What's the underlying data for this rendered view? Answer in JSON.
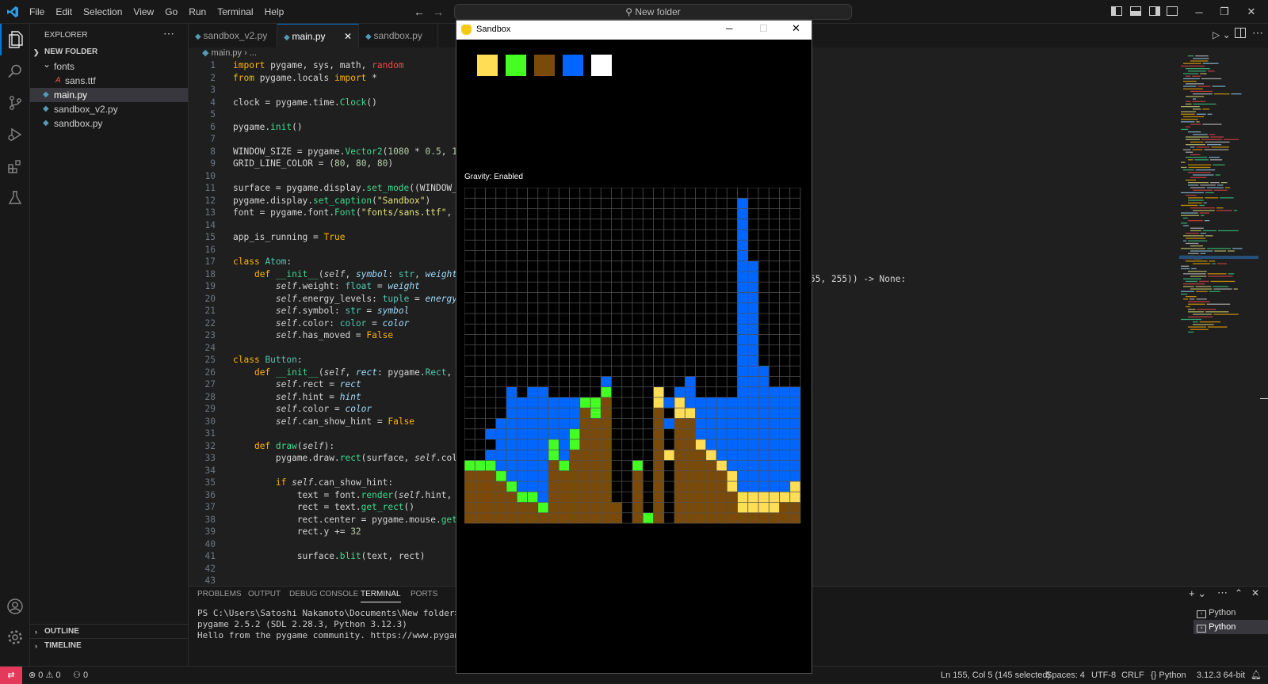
{
  "menu": [
    "File",
    "Edit",
    "Selection",
    "View",
    "Go",
    "Run",
    "Terminal",
    "Help"
  ],
  "command_center": "New folder",
  "explorer": {
    "header": "EXPLORER",
    "folder": "NEW FOLDER",
    "items": [
      {
        "label": "fonts",
        "type": "folder",
        "depth": 1
      },
      {
        "label": "sans.ttf",
        "type": "font",
        "depth": 2
      },
      {
        "label": "main.py",
        "type": "py",
        "depth": 1,
        "selected": true
      },
      {
        "label": "sandbox_v2.py",
        "type": "py",
        "depth": 1
      },
      {
        "label": "sandbox.py",
        "type": "py",
        "depth": 1
      }
    ],
    "outline": "OUTLINE",
    "timeline": "TIMELINE"
  },
  "tabs": [
    {
      "label": "sandbox_v2.py",
      "active": false
    },
    {
      "label": "main.py",
      "active": true
    },
    {
      "label": "sandbox.py",
      "active": false
    }
  ],
  "breadcrumb": [
    "main.py",
    "..."
  ],
  "code_lines": [
    [
      [
        "kw",
        "import"
      ],
      [
        "op",
        " pygame, sys, math, "
      ],
      [
        "var",
        "random"
      ]
    ],
    [
      [
        "kw",
        "from"
      ],
      [
        "op",
        " pygame.locals "
      ],
      [
        "kw",
        "import"
      ],
      [
        "op",
        " *"
      ]
    ],
    [],
    [
      [
        "op",
        "clock = pygame.time."
      ],
      [
        "fn",
        "Clock"
      ],
      [
        "op",
        "()"
      ]
    ],
    [],
    [
      [
        "op",
        "pygame."
      ],
      [
        "fn",
        "init"
      ],
      [
        "op",
        "()"
      ]
    ],
    [],
    [
      [
        "op",
        "WINDOW_SIZE = pygame."
      ],
      [
        "fn",
        "Vector2"
      ],
      [
        "op",
        "("
      ],
      [
        "num",
        "1080"
      ],
      [
        "op",
        " * "
      ],
      [
        "num",
        "0.5"
      ],
      [
        "op",
        ", "
      ],
      [
        "num",
        "192"
      ]
    ],
    [
      [
        "op",
        "GRID_LINE_COLOR = ("
      ],
      [
        "num",
        "80"
      ],
      [
        "op",
        ", "
      ],
      [
        "num",
        "80"
      ],
      [
        "op",
        ", "
      ],
      [
        "num",
        "80"
      ],
      [
        "op",
        ")"
      ]
    ],
    [],
    [
      [
        "op",
        "surface = pygame.display."
      ],
      [
        "fn",
        "set_mode"
      ],
      [
        "op",
        "((WINDOW_SI"
      ]
    ],
    [
      [
        "op",
        "pygame.display."
      ],
      [
        "fn",
        "set_caption"
      ],
      [
        "op",
        "("
      ],
      [
        "str",
        "\"Sandbox\""
      ],
      [
        "op",
        ")"
      ]
    ],
    [
      [
        "op",
        "font = pygame.font."
      ],
      [
        "fn",
        "Font"
      ],
      [
        "op",
        "("
      ],
      [
        "str",
        "\"fonts/sans.ttf\""
      ],
      [
        "op",
        ", "
      ],
      [
        "num",
        "12"
      ]
    ],
    [],
    [
      [
        "op",
        "app_is_running = "
      ],
      [
        "kw",
        "True"
      ]
    ],
    [],
    [
      [
        "kw",
        "class"
      ],
      [
        "op",
        " "
      ],
      [
        "cls",
        "Atom"
      ],
      [
        "op",
        ":"
      ]
    ],
    [
      [
        "op",
        "    "
      ],
      [
        "kw",
        "def"
      ],
      [
        "op",
        " "
      ],
      [
        "fn",
        "__init__"
      ],
      [
        "op",
        "("
      ],
      [
        "self",
        "self"
      ],
      [
        "op",
        ", "
      ],
      [
        "prm",
        "symbol"
      ],
      [
        "op",
        ": "
      ],
      [
        "cls",
        "str"
      ],
      [
        "op",
        ", "
      ],
      [
        "prm",
        "weight"
      ],
      [
        "op",
        ":"
      ]
    ],
    [
      [
        "op",
        "        "
      ],
      [
        "self",
        "self"
      ],
      [
        "op",
        ".weight: "
      ],
      [
        "cls",
        "float"
      ],
      [
        "op",
        " = "
      ],
      [
        "prm",
        "weight"
      ]
    ],
    [
      [
        "op",
        "        "
      ],
      [
        "self",
        "self"
      ],
      [
        "op",
        ".energy_levels: "
      ],
      [
        "cls",
        "tuple"
      ],
      [
        "op",
        " = "
      ],
      [
        "prm",
        "energy_l"
      ]
    ],
    [
      [
        "op",
        "        "
      ],
      [
        "self",
        "self"
      ],
      [
        "op",
        ".symbol: "
      ],
      [
        "cls",
        "str"
      ],
      [
        "op",
        " = "
      ],
      [
        "prm",
        "symbol"
      ]
    ],
    [
      [
        "op",
        "        "
      ],
      [
        "self",
        "self"
      ],
      [
        "op",
        ".color: "
      ],
      [
        "cls",
        "color"
      ],
      [
        "op",
        " = "
      ],
      [
        "prm",
        "color"
      ]
    ],
    [
      [
        "op",
        "        "
      ],
      [
        "self",
        "self"
      ],
      [
        "op",
        ".has_moved = "
      ],
      [
        "kw",
        "False"
      ]
    ],
    [],
    [
      [
        "kw",
        "class"
      ],
      [
        "op",
        " "
      ],
      [
        "cls",
        "Button"
      ],
      [
        "op",
        ":"
      ]
    ],
    [
      [
        "op",
        "    "
      ],
      [
        "kw",
        "def"
      ],
      [
        "op",
        " "
      ],
      [
        "fn",
        "__init__"
      ],
      [
        "op",
        "("
      ],
      [
        "self",
        "self"
      ],
      [
        "op",
        ", "
      ],
      [
        "prm",
        "rect"
      ],
      [
        "op",
        ": pygame."
      ],
      [
        "cls",
        "Rect"
      ],
      [
        "op",
        ", "
      ],
      [
        "prm",
        "co"
      ]
    ],
    [
      [
        "op",
        "        "
      ],
      [
        "self",
        "self"
      ],
      [
        "op",
        ".rect = "
      ],
      [
        "prm",
        "rect"
      ]
    ],
    [
      [
        "op",
        "        "
      ],
      [
        "self",
        "self"
      ],
      [
        "op",
        ".hint = "
      ],
      [
        "prm",
        "hint"
      ]
    ],
    [
      [
        "op",
        "        "
      ],
      [
        "self",
        "self"
      ],
      [
        "op",
        ".color = "
      ],
      [
        "prm",
        "color"
      ]
    ],
    [
      [
        "op",
        "        "
      ],
      [
        "self",
        "self"
      ],
      [
        "op",
        ".can_show_hint = "
      ],
      [
        "kw",
        "False"
      ]
    ],
    [],
    [
      [
        "op",
        "    "
      ],
      [
        "kw",
        "def"
      ],
      [
        "op",
        " "
      ],
      [
        "fn",
        "draw"
      ],
      [
        "op",
        "("
      ],
      [
        "self",
        "self"
      ],
      [
        "op",
        "):"
      ]
    ],
    [
      [
        "op",
        "        pygame.draw."
      ],
      [
        "fn",
        "rect"
      ],
      [
        "op",
        "(surface, "
      ],
      [
        "self",
        "self"
      ],
      [
        "op",
        ".color"
      ]
    ],
    [],
    [
      [
        "op",
        "        "
      ],
      [
        "kw",
        "if"
      ],
      [
        "op",
        " "
      ],
      [
        "self",
        "self"
      ],
      [
        "op",
        ".can_show_hint:"
      ]
    ],
    [
      [
        "op",
        "            text = font."
      ],
      [
        "fn",
        "render"
      ],
      [
        "op",
        "("
      ],
      [
        "self",
        "self"
      ],
      [
        "op",
        ".hint, Tr"
      ]
    ],
    [
      [
        "op",
        "            rect = text."
      ],
      [
        "fn",
        "get_rect"
      ],
      [
        "op",
        "()"
      ]
    ],
    [
      [
        "op",
        "            rect.center = pygame.mouse."
      ],
      [
        "fn",
        "get_p"
      ]
    ],
    [
      [
        "op",
        "            rect.y += "
      ],
      [
        "num",
        "32"
      ]
    ],
    [],
    [
      [
        "op",
        "            surface."
      ],
      [
        "fn",
        "blit"
      ],
      [
        "op",
        "(text, rect)"
      ]
    ],
    [],
    []
  ],
  "code_overflow_text": "55, 255)) -> None:",
  "panel": {
    "tabs": [
      {
        "label": "PROBLEMS",
        "active": false
      },
      {
        "label": "OUTPUT",
        "active": false
      },
      {
        "label": "DEBUG CONSOLE",
        "active": false
      },
      {
        "label": "TERMINAL",
        "active": true
      },
      {
        "label": "PORTS",
        "active": false
      }
    ],
    "terminal_lines": [
      "PS C:\\Users\\Satoshi Nakamoto\\Documents\\New folder> & C:",
      "pygame 2.5.2 (SDL 2.28.3, Python 3.12.3)",
      "Hello from the pygame community. https://www.pygame.org"
    ],
    "terminals": [
      "Python",
      "Python"
    ]
  },
  "status": {
    "errors": "0",
    "warnings": "0",
    "ports": "0",
    "cursor": "Ln 155, Col 5 (145 selected)",
    "spaces": "Spaces: 4",
    "encoding": "UTF-8",
    "eol": "CRLF",
    "language": "Python",
    "interpreter": "3.12.3 64-bit"
  },
  "sandbox": {
    "title": "Sandbox",
    "gravity_label": "Gravity: Enabled",
    "palette": [
      "#ffdd55",
      "#44ff22",
      "#7a4a0a",
      "#0066ff",
      "#ffffff"
    ],
    "colors": {
      "S": "#ffdd55",
      "G": "#44ff22",
      "D": "#7a4a0a",
      "W": "#0066ff",
      "k": "#000000"
    },
    "grid_cols": 32,
    "grid_rows": 32,
    "grid_line_color": "#505050",
    "grid": [
      "................................",
      "................................",
      "................................",
      "................................",
      "................................",
      "................................",
      "................................",
      "..........................W.....",
      "..........................W.....",
      "..........................W.....",
      "..........................W.....",
      "..........................W.....",
      "..........................W.....",
      "..........................W.....",
      "..........................W.....",
      "..........................W.....",
      "..........................W.....",
      "..........................W.....",
      "..........................W.....",
      ".......W.............................",
      "................................",
      "................................",
      "................................",
      "................................",
      "................................",
      "................................",
      "................................",
      "................................",
      "................................",
      "................................",
      "................................",
      "................................"
    ],
    "columns": [
      {
        "h": 6,
        "cells": "GDDDDD"
      },
      {
        "h": 7,
        "cells": ".GDDDDD"
      },
      {
        "h": 9,
        "cells": "W.WGDDDDD"
      },
      {
        "h": 10,
        "cells": "WWWWWGDDDD"
      },
      {
        "h": 15,
        "cells": "WWWWWWWWWGDDD"
      },
      {
        "h": 15,
        "cells": "WWWWWWWWWGDD"
      },
      {
        "h": 15,
        "cells": "WWWWWWWWWWGDD"
      },
      {
        "h": 13,
        "cells": "WWWWWWWWWWWGD"
      },
      {
        "h": 12,
        "cells": "WWWWGGDDDDDD"
      },
      {
        "h": 12,
        "cells": "WWWWWWGDDDDD"
      },
      {
        "h": 12,
        "cells": "WWWGGDDDDDDD"
      },
      {
        "h": 12,
        "cells": "GDDDDDDDDDDD"
      },
      {
        "h": 12,
        "cells": "GGDDDDDDDDDD"
      },
      {
        "h": 13,
        "cells": "WGDDDDDDDDDDDD"
      },
      {
        "h": 2,
        "cells": "DD"
      },
      {
        "h": 1,
        "cells": "k"
      },
      {
        "h": 6,
        "cells": "GDDDDD"
      },
      {
        "h": 1,
        "cells": "G"
      },
      {
        "h": 13,
        "cells": "SSDDDDDDDDDDD"
      },
      {
        "h": 12,
        "cells": "WkWkkSkkkkkk"
      },
      {
        "h": 13,
        "cells": "WSSDDDDDDDDDD"
      },
      {
        "h": 14,
        "cells": "WWWSDDDDDDDDDD"
      },
      {
        "h": 14,
        "cells": "WWWWSDDDDDDD"
      },
      {
        "h": 14,
        "cells": "WWWWWSDDDDDD"
      },
      {
        "h": 14,
        "cells": "WWWWWWSDDDDD"
      },
      {
        "h": 14,
        "cells": "WWWWWWWSSDDD"
      },
      {
        "h": 31,
        "cells": "WWWWWWWWWWWWWWWWWWWWWWWWWWWWSSD"
      },
      {
        "h": 25,
        "cells": "WWWWWWWWWWWWWWWWWWWWWWSSD"
      },
      {
        "h": 15,
        "cells": "WWWWWWWWWWWWSSD"
      },
      {
        "h": 13,
        "cells": "WWWWWWWWWWSSD"
      },
      {
        "h": 13,
        "cells": "WWWWWWWWWWSDD"
      },
      {
        "h": 13,
        "cells": "WWWWWWWWWSSDD"
      }
    ]
  }
}
